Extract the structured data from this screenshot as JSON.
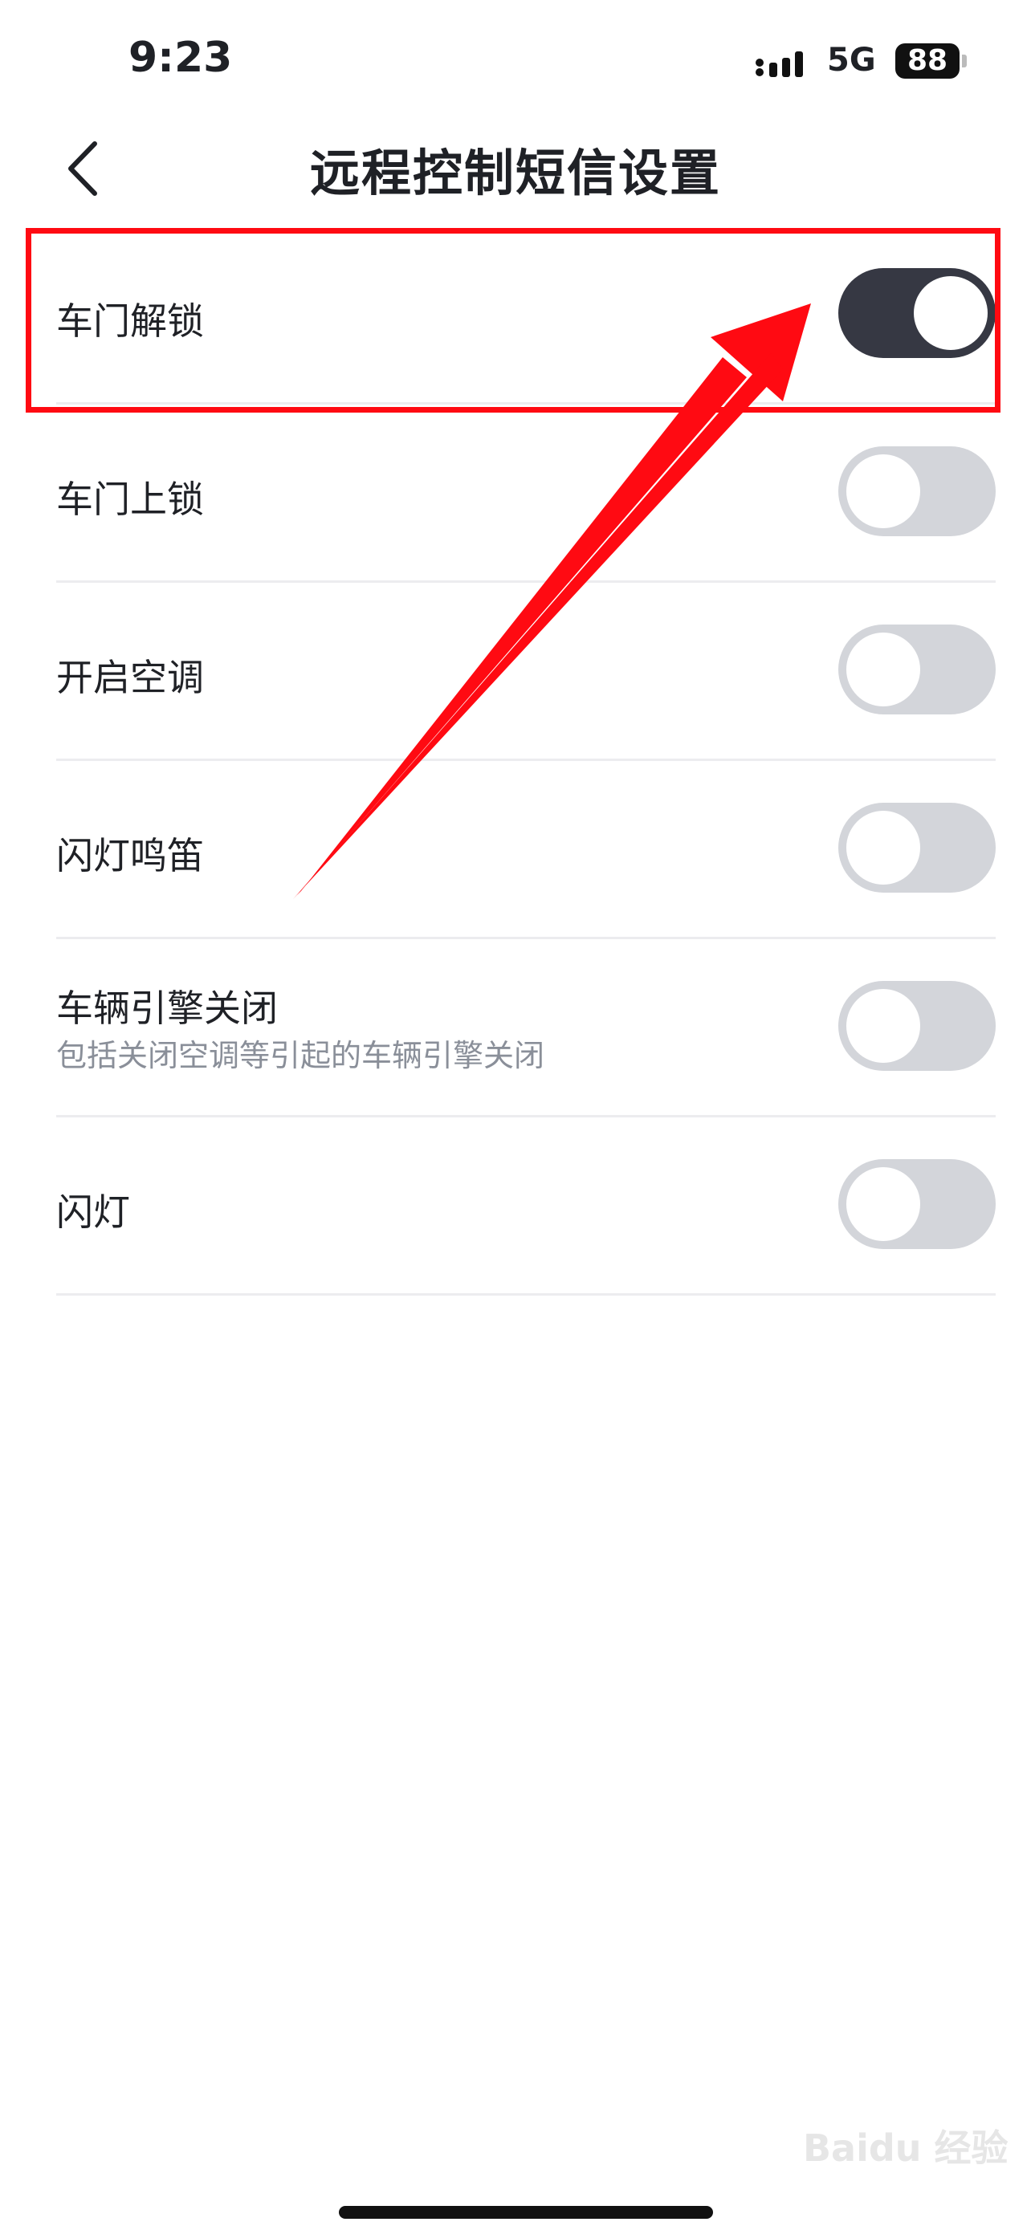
{
  "status_bar": {
    "time": "9:23",
    "network": "5G",
    "battery": "88"
  },
  "nav": {
    "title": "远程控制短信设置"
  },
  "settings": [
    {
      "label": "车门解锁",
      "sub": "",
      "enabled": true
    },
    {
      "label": "车门上锁",
      "sub": "",
      "enabled": false
    },
    {
      "label": "开启空调",
      "sub": "",
      "enabled": false
    },
    {
      "label": "闪灯鸣笛",
      "sub": "",
      "enabled": false
    },
    {
      "label": "车辆引擎关闭",
      "sub": "包括关闭空调等引起的车辆引擎关闭",
      "enabled": false
    },
    {
      "label": "闪灯",
      "sub": "",
      "enabled": false
    }
  ],
  "watermark": "Baidu 经验",
  "colors": {
    "toggle_on": "#363843",
    "toggle_off": "#d3d5da",
    "annotation": "#ff0a12"
  }
}
